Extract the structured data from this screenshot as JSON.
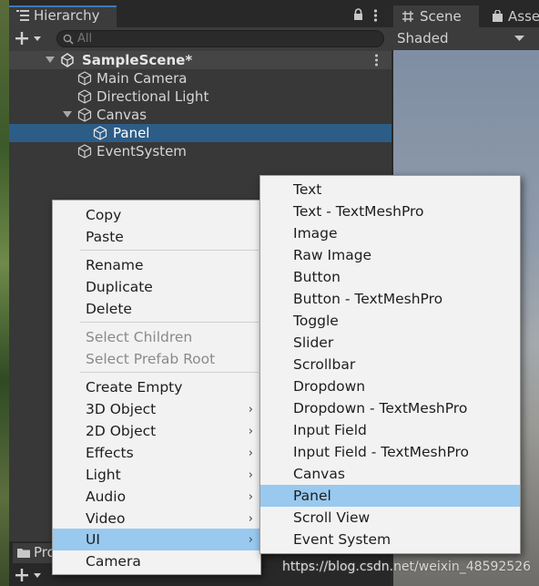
{
  "hierarchy": {
    "tab_label": "Hierarchy",
    "search_placeholder": "All",
    "scene_name": "SampleScene*",
    "items": [
      {
        "label": "Main Camera"
      },
      {
        "label": "Directional Light"
      },
      {
        "label": "Canvas"
      },
      {
        "label": "Panel"
      },
      {
        "label": "EventSystem"
      }
    ]
  },
  "scene_view": {
    "tab_scene": "Scene",
    "tab_assets": "Asse",
    "shading_mode": "Shaded"
  },
  "project": {
    "tab_label": "Pro"
  },
  "context_menu": {
    "items": [
      {
        "label": "Copy"
      },
      {
        "label": "Paste"
      },
      {
        "label": "Rename"
      },
      {
        "label": "Duplicate"
      },
      {
        "label": "Delete"
      },
      {
        "label": "Select Children"
      },
      {
        "label": "Select Prefab Root"
      },
      {
        "label": "Create Empty"
      },
      {
        "label": "3D Object"
      },
      {
        "label": "2D Object"
      },
      {
        "label": "Effects"
      },
      {
        "label": "Light"
      },
      {
        "label": "Audio"
      },
      {
        "label": "Video"
      },
      {
        "label": "UI"
      },
      {
        "label": "Camera"
      }
    ]
  },
  "ui_submenu": {
    "items": [
      {
        "label": "Text"
      },
      {
        "label": "Text - TextMeshPro"
      },
      {
        "label": "Image"
      },
      {
        "label": "Raw Image"
      },
      {
        "label": "Button"
      },
      {
        "label": "Button - TextMeshPro"
      },
      {
        "label": "Toggle"
      },
      {
        "label": "Slider"
      },
      {
        "label": "Scrollbar"
      },
      {
        "label": "Dropdown"
      },
      {
        "label": "Dropdown - TextMeshPro"
      },
      {
        "label": "Input Field"
      },
      {
        "label": "Input Field - TextMeshPro"
      },
      {
        "label": "Canvas"
      },
      {
        "label": "Panel"
      },
      {
        "label": "Scroll View"
      },
      {
        "label": "Event System"
      }
    ]
  },
  "watermark": "https://blog.csdn.net/weixin_48592526",
  "colors": {
    "highlight": "#99c9ef",
    "selection": "#2c5d87",
    "menu_bg": "#f2f2f2",
    "panel_bg": "#383838"
  }
}
